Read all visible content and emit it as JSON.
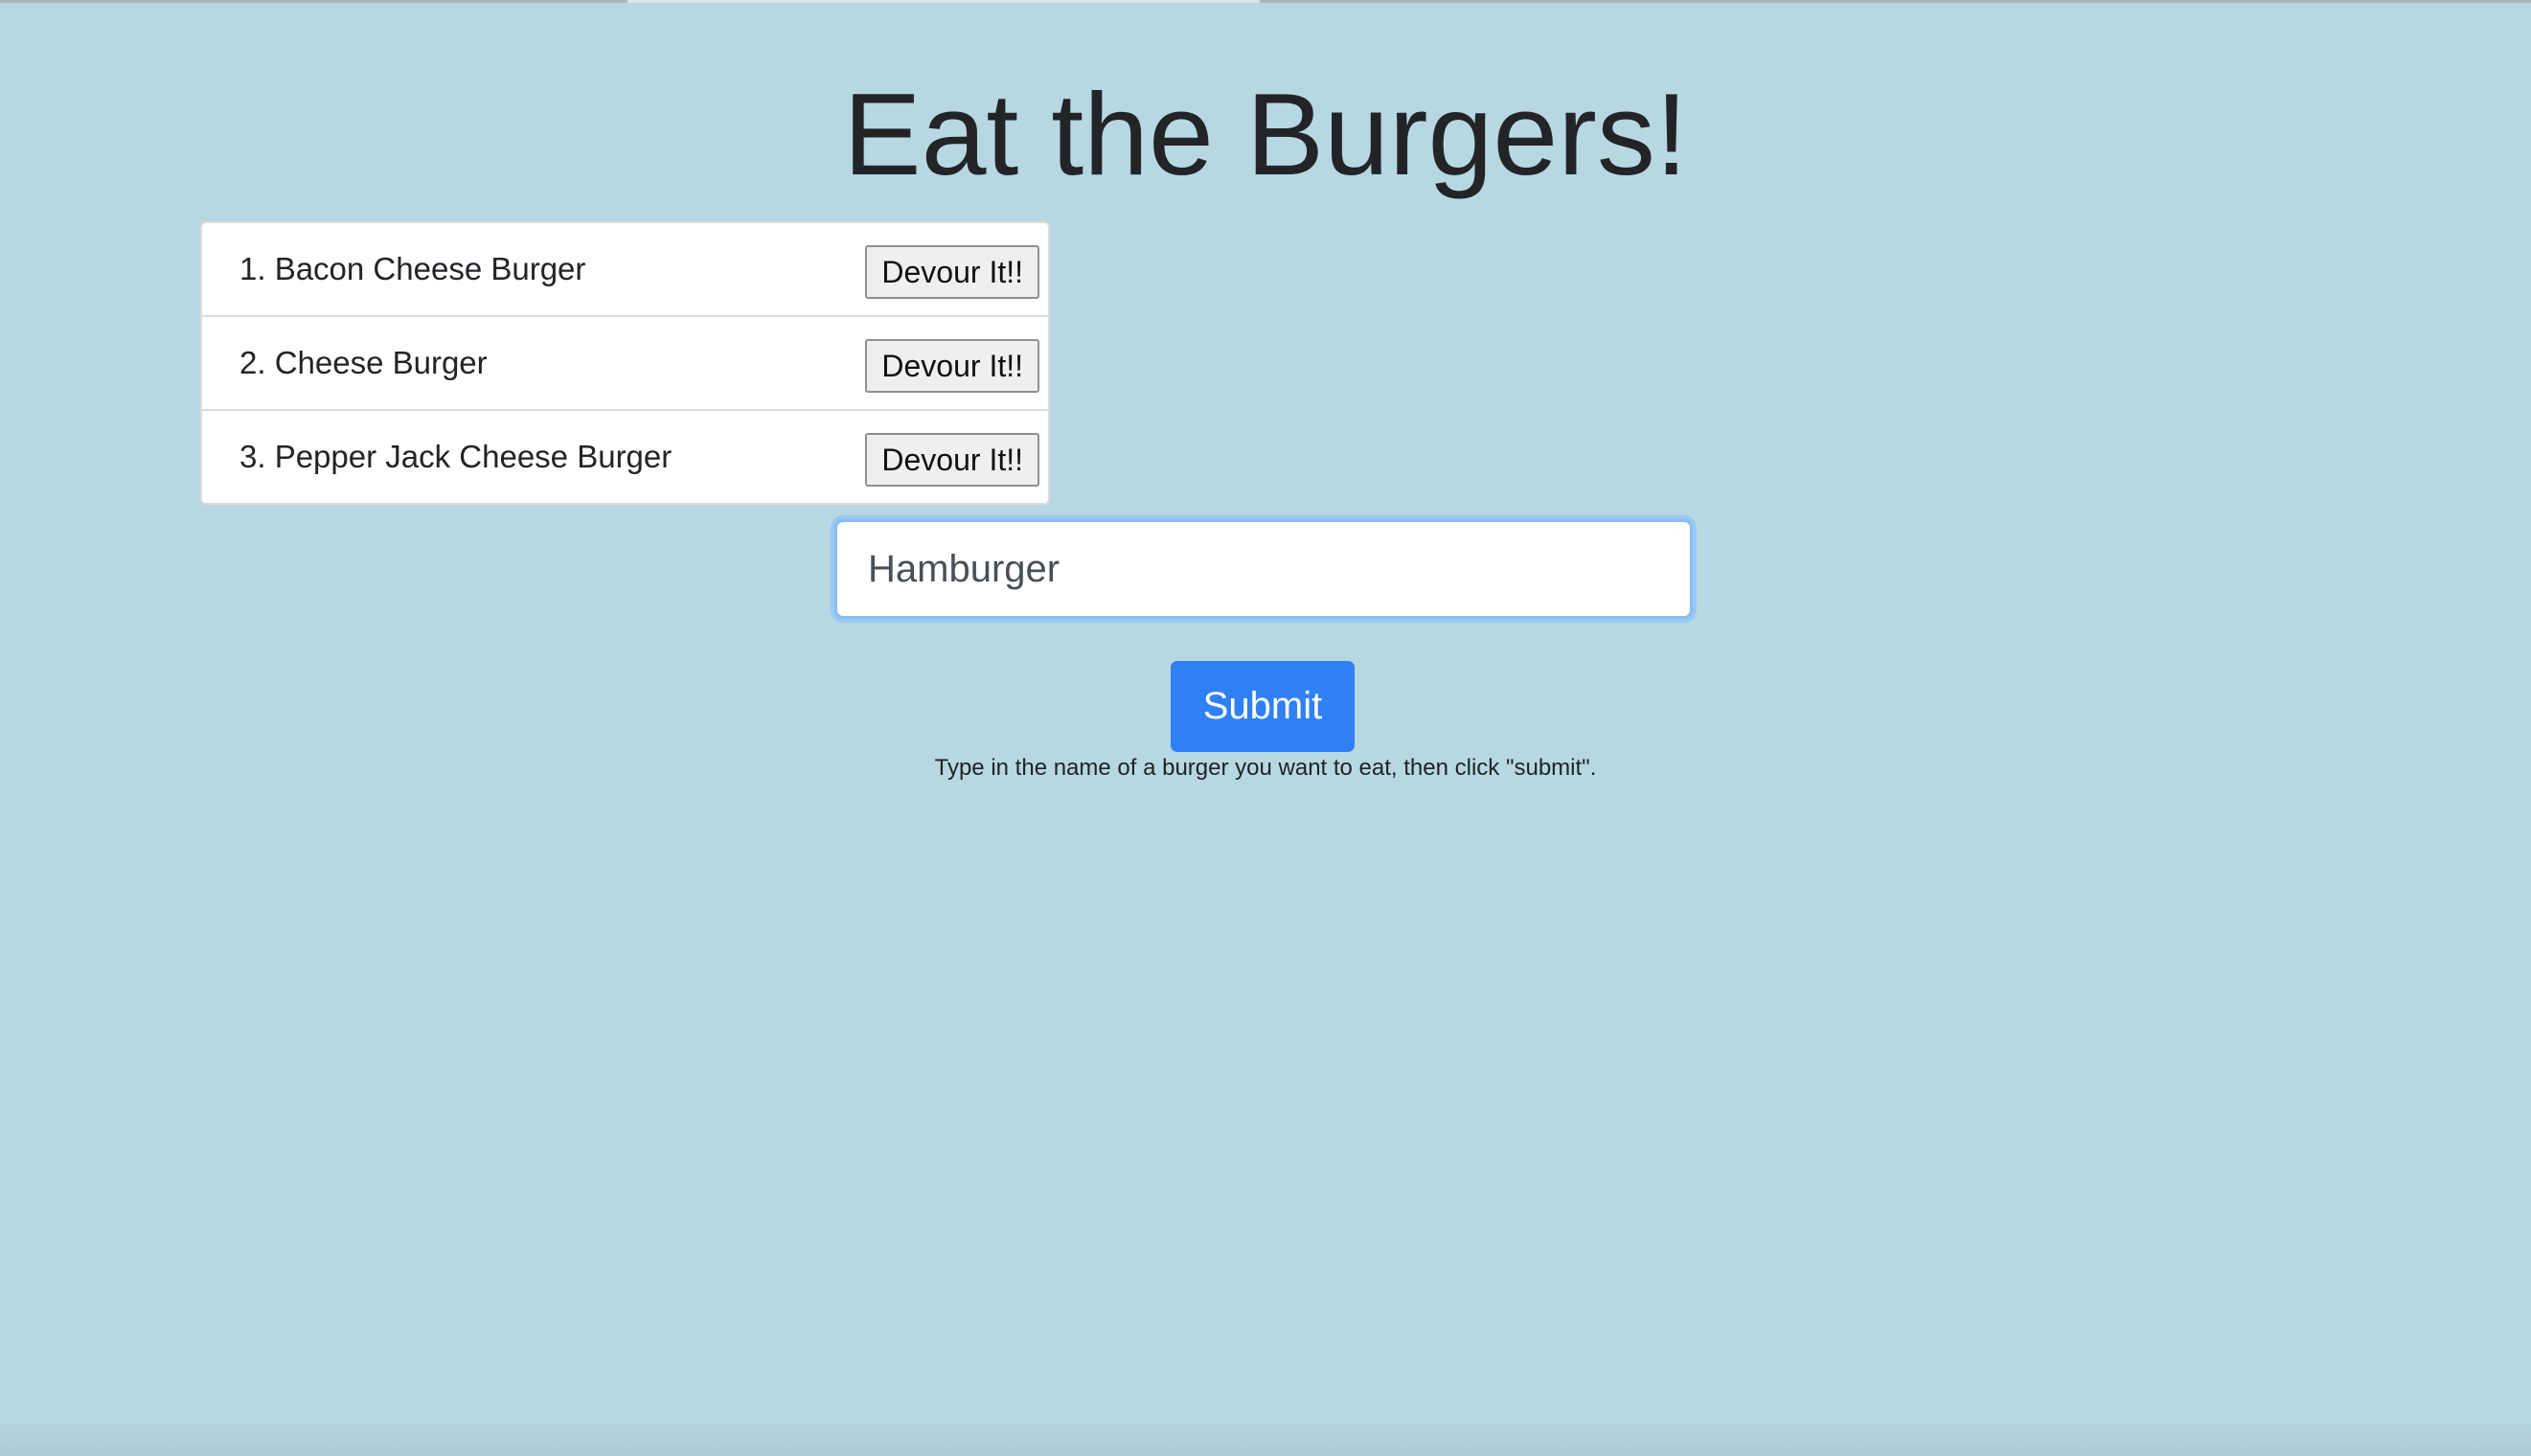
{
  "page": {
    "title": "Eat the Burgers!",
    "background_color": "#b7d7e3"
  },
  "burgers": {
    "items": [
      {
        "name": "1. Bacon Cheese Burger",
        "button_label": "Devour It!!"
      },
      {
        "name": "2. Cheese Burger",
        "button_label": "Devour It!!"
      },
      {
        "name": "3. Pepper Jack Cheese Burger",
        "button_label": "Devour It!!"
      }
    ]
  },
  "form": {
    "input_value": "Hamburger",
    "submit_label": "Submit",
    "submit_color": "#2f80f4",
    "instructions": "Type in the name of a burger you want to eat, then click \"submit\"."
  }
}
